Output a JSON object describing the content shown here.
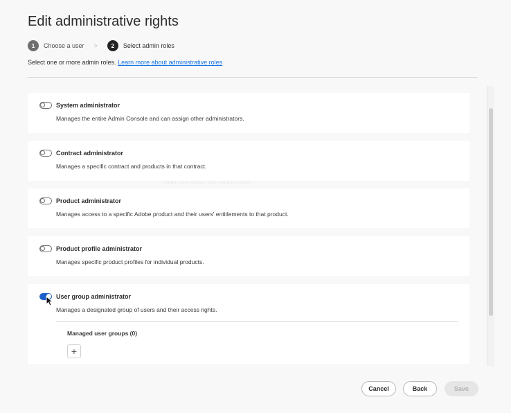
{
  "page": {
    "title": "Edit administrative rights",
    "description": "Select one or more admin roles.",
    "learn_more_link": "Learn more about administrative roles"
  },
  "stepper": {
    "steps": [
      {
        "number": "1",
        "label": "Choose a user",
        "state": "complete"
      },
      {
        "number": "2",
        "label": "Select admin roles",
        "state": "active"
      }
    ],
    "separator": ">"
  },
  "roles": [
    {
      "title": "System administrator",
      "description": "Manages the entire Admin Console and can assign other administrators.",
      "enabled": false
    },
    {
      "title": "Contract administrator",
      "description": "Manages a specific contract and products in that contract.",
      "enabled": false
    },
    {
      "title": "Product administrator",
      "description": "Manages access to a specific Adobe product and their users' entitlements to that product.",
      "enabled": false
    },
    {
      "title": "Product profile administrator",
      "description": "Manages specific product profiles for individual products.",
      "enabled": false
    },
    {
      "title": "User group administrator",
      "description": "Manages a designated group of users and their access rights.",
      "enabled": true
    }
  ],
  "user_group_section": {
    "managed_label": "Managed user groups (0)",
    "add_icon": "+"
  },
  "footer": {
    "cancel_label": "Cancel",
    "back_label": "Back",
    "save_label": "Save"
  },
  "colors": {
    "accent": "#1d5fc9",
    "link": "#1473e6",
    "background": "#f8f8f8"
  }
}
